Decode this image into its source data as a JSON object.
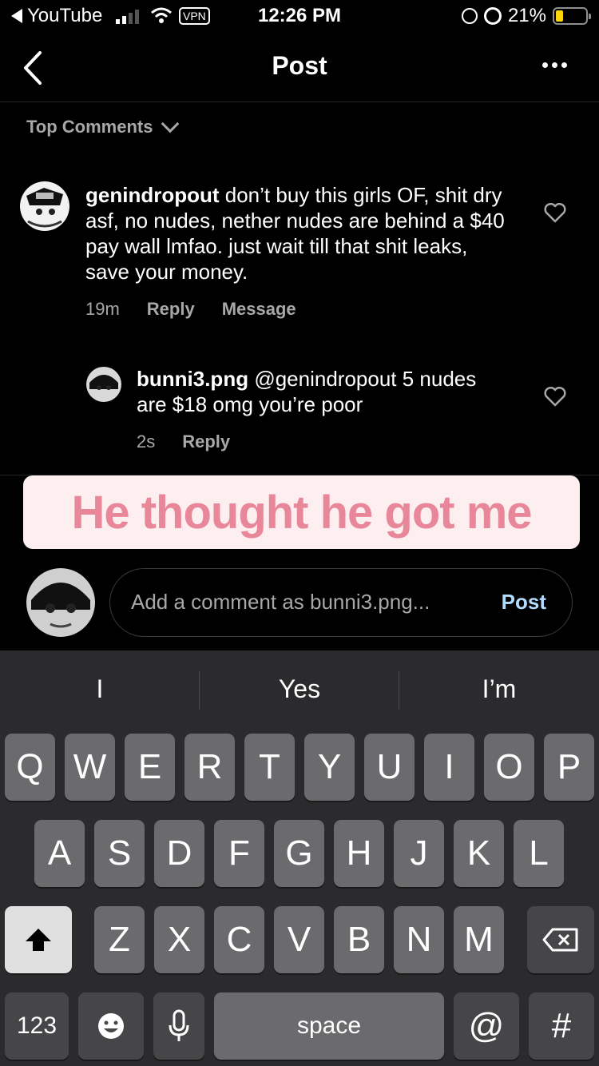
{
  "status_bar": {
    "back_app": "YouTube",
    "vpn": "VPN",
    "time": "12:26 PM",
    "battery_pct": "21%"
  },
  "nav": {
    "title": "Post"
  },
  "sort": {
    "label": "Top Comments"
  },
  "comments": [
    {
      "username": "genindropout",
      "text": "don’t buy this girls OF, shit dry asf, no nudes, nether nudes are behind a $40 pay wall lmfao. just wait till that shit leaks, save your money.",
      "time": "19m",
      "reply_label": "Reply",
      "message_label": "Message"
    },
    {
      "username": "bunni3.png",
      "text": "@genindropout 5 nudes are $18 omg you’re poor",
      "time": "2s",
      "reply_label": "Reply"
    }
  ],
  "banner": {
    "text": "He thought he got me"
  },
  "composer": {
    "placeholder": "Add a comment as bunni3.png...",
    "post_label": "Post"
  },
  "keyboard": {
    "suggestions": [
      "I",
      "Yes",
      "I’m"
    ],
    "row1": [
      "Q",
      "W",
      "E",
      "R",
      "T",
      "Y",
      "U",
      "I",
      "O",
      "P"
    ],
    "row2": [
      "A",
      "S",
      "D",
      "F",
      "G",
      "H",
      "J",
      "K",
      "L"
    ],
    "row3": [
      "Z",
      "X",
      "C",
      "V",
      "B",
      "N",
      "M"
    ],
    "numbers": "123",
    "space": "space",
    "at": "@",
    "hash": "#"
  },
  "colors": {
    "banner_bg": "#fdeef0",
    "banner_text": "#e9879a",
    "post_link": "#b3dbff"
  }
}
